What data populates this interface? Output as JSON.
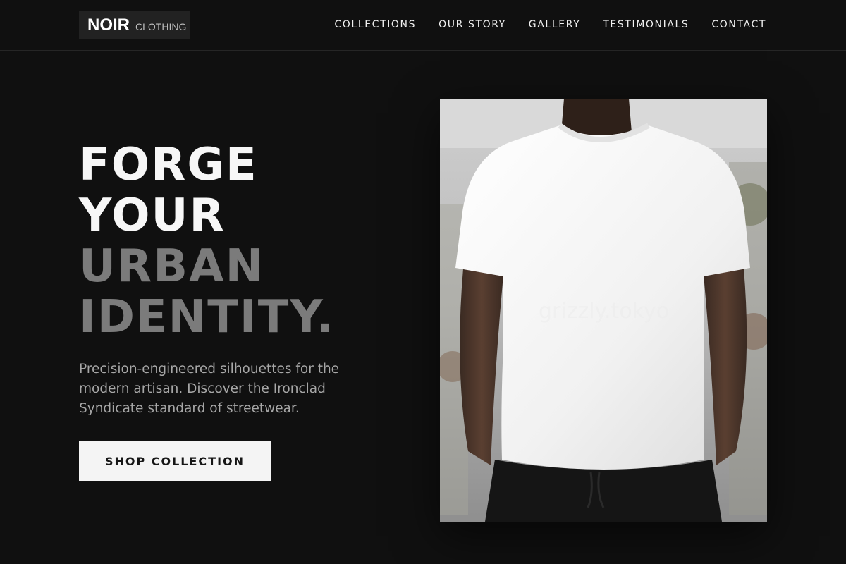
{
  "brand": {
    "name": "NOIR",
    "sub": "CLOTHING"
  },
  "nav": {
    "items": [
      {
        "label": "COLLECTIONS"
      },
      {
        "label": "OUR STORY"
      },
      {
        "label": "GALLERY"
      },
      {
        "label": "TESTIMONIALS"
      },
      {
        "label": "CONTACT"
      }
    ]
  },
  "hero": {
    "line1": "FORGE",
    "line2": "YOUR",
    "line3": "URBAN",
    "line4": "IDENTITY.",
    "description": "Precision-engineered silhouettes for the modern artisan. Discover the Ironclad Syndicate standard of streetwear.",
    "cta_label": "SHOP COLLECTION"
  },
  "image": {
    "watermark": "grizzly.tokyo"
  },
  "colors": {
    "background": "#101010",
    "headline_light": "#f7f7f7",
    "headline_dim": "#7b7b7b",
    "cta_bg": "#f4f4f4"
  }
}
